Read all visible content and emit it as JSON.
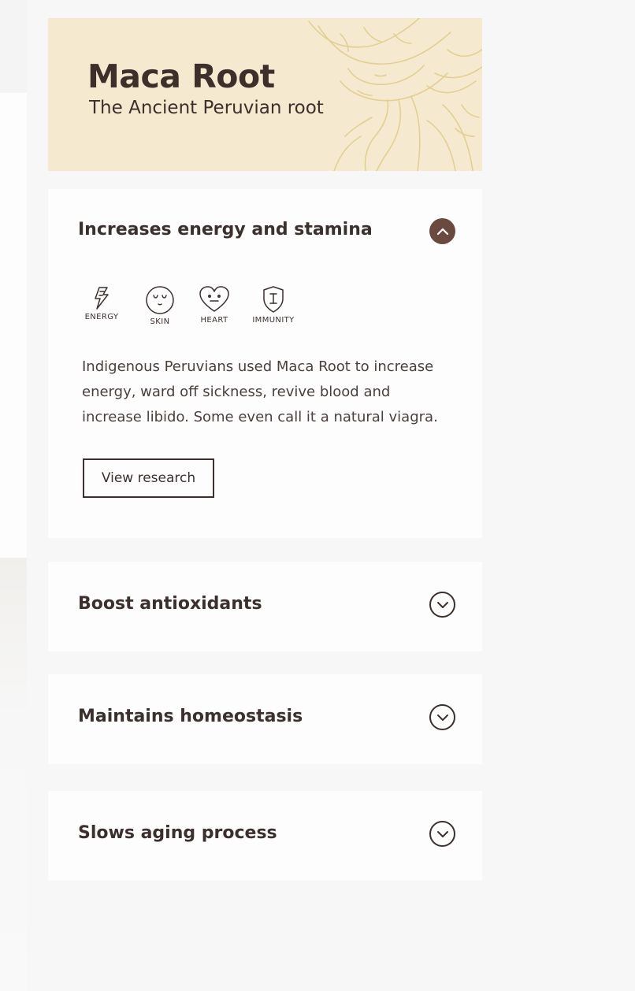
{
  "hero": {
    "title": "Maca Root",
    "subtitle": "The Ancient Peruvian root",
    "background_color": "#f5ead0",
    "illustration_color": "#e6d39a"
  },
  "accordion": [
    {
      "title": "Increases energy and stamina",
      "expanded": true,
      "toggle_icon": "chevron-up-icon",
      "benefits": [
        {
          "label": "ENERGY",
          "icon": "lightning-icon"
        },
        {
          "label": "SKIN",
          "icon": "face-icon"
        },
        {
          "label": "HEART",
          "icon": "heart-icon"
        },
        {
          "label": "IMMUNITY",
          "icon": "shield-icon"
        }
      ],
      "description": "Indigenous Peruvians used Maca Root to increase energy, ward off sickness, revive blood and increase libido. Some even call it a natural viagra.",
      "button_label": "View research"
    },
    {
      "title": "Boost antioxidants",
      "expanded": false,
      "toggle_icon": "chevron-down-icon"
    },
    {
      "title": "Maintains homeostasis",
      "expanded": false,
      "toggle_icon": "chevron-down-icon"
    },
    {
      "title": "Slows aging process",
      "expanded": false,
      "toggle_icon": "chevron-down-icon"
    }
  ],
  "colors": {
    "text": "#3b302d",
    "accent_toggle": "#6a4a3e",
    "panel_bg": "#fdfdfd",
    "page_bg": "#f4f4f4"
  }
}
